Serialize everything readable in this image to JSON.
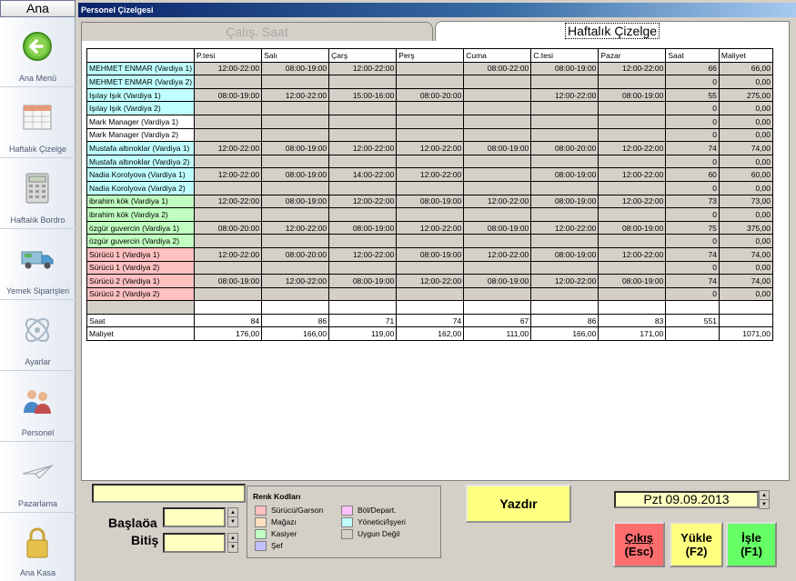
{
  "sidebar": {
    "header": "Ana",
    "items": [
      {
        "label": "Ana Menü",
        "icon": "back-arrow-icon"
      },
      {
        "label": "Haftalık Çizelge",
        "icon": "calendar-icon"
      },
      {
        "label": "Haftalık Bordro",
        "icon": "calculator-icon"
      },
      {
        "label": "Yemek Siparişleri",
        "icon": "delivery-truck-icon"
      },
      {
        "label": "Ayarlar",
        "icon": "settings-icon"
      },
      {
        "label": "Personel",
        "icon": "people-icon"
      },
      {
        "label": "Pazarlama",
        "icon": "paper-plane-icon"
      },
      {
        "label": "Ana Kasa",
        "icon": "lock-icon"
      }
    ]
  },
  "window": {
    "title": "Personel Çizelgesi"
  },
  "tabs": {
    "calis": "Çalış. Saat",
    "haftalik": "Haftalık Çizelge"
  },
  "grid": {
    "headers": [
      "",
      "P.tesi",
      "Salı",
      "Çarş",
      "Perş",
      "Cuma",
      "C.tesi",
      "Pazar",
      "Saat",
      "Maliyet"
    ],
    "rows": [
      {
        "name": "MEHMET ENMAR (Vardiya 1)",
        "color": "#c0ffff",
        "cells": [
          "12:00-22:00",
          "08:00-19:00",
          "12:00-22:00",
          "",
          "08:00-22:00",
          "08:00-19:00",
          "12:00-22:00"
        ],
        "saat": "66",
        "maliyet": "66,00"
      },
      {
        "name": "MEHMET ENMAR (Vardiya 2)",
        "color": "#c0ffff",
        "cells": [
          "",
          "",
          "",
          "",
          "",
          "",
          ""
        ],
        "saat": "0",
        "maliyet": "0,00"
      },
      {
        "name": "Işılay Işık (Vardiya 1)",
        "color": "#c0ffff",
        "cells": [
          "08:00-19:00",
          "12:00-22:00",
          "15:00-16:00",
          "08:00-20:00",
          "",
          "12:00-22:00",
          "08:00-19:00"
        ],
        "saat": "55",
        "maliyet": "275,00"
      },
      {
        "name": "Işılay Işık (Vardiya 2)",
        "color": "#c0ffff",
        "cells": [
          "",
          "",
          "",
          "",
          "",
          "",
          ""
        ],
        "saat": "0",
        "maliyet": "0,00"
      },
      {
        "name": "Mark Manager (Vardiya 1)",
        "color": "#ffffff",
        "cells": [
          "",
          "",
          "",
          "",
          "",
          "",
          ""
        ],
        "saat": "0",
        "maliyet": "0,00"
      },
      {
        "name": "Mark Manager (Vardiya 2)",
        "color": "#ffffff",
        "cells": [
          "",
          "",
          "",
          "",
          "",
          "",
          ""
        ],
        "saat": "0",
        "maliyet": "0,00"
      },
      {
        "name": "Mustafa altınoklar (Vardiya 1)",
        "color": "#c0ffff",
        "cells": [
          "12:00-22:00",
          "08:00-19:00",
          "12:00-22:00",
          "12:00-22:00",
          "08:00-19:00",
          "08:00-20:00",
          "12:00-22:00"
        ],
        "saat": "74",
        "maliyet": "74,00"
      },
      {
        "name": "Mustafa altınoklar (Vardiya 2)",
        "color": "#c0ffff",
        "cells": [
          "",
          "",
          "",
          "",
          "",
          "",
          ""
        ],
        "saat": "0",
        "maliyet": "0,00"
      },
      {
        "name": "Nadia Korolyova (Vardiya 1)",
        "color": "#c0ffff",
        "cells": [
          "12:00-22:00",
          "08:00-19:00",
          "14:00-22:00",
          "12:00-22:00",
          "",
          "08:00-19:00",
          "12:00-22:00"
        ],
        "saat": "60",
        "maliyet": "60,00"
      },
      {
        "name": "Nadia Korolyova (Vardiya 2)",
        "color": "#c0ffff",
        "cells": [
          "",
          "",
          "",
          "",
          "",
          "",
          ""
        ],
        "saat": "0",
        "maliyet": "0,00"
      },
      {
        "name": "ibrahim kök (Vardiya 1)",
        "color": "#c0ffc0",
        "cells": [
          "12:00-22:00",
          "08:00-19:00",
          "12:00-22:00",
          "08:00-19:00",
          "12:00-22:00",
          "08:00-19:00",
          "12:00-22:00"
        ],
        "saat": "73",
        "maliyet": "73,00"
      },
      {
        "name": "ibrahim kök (Vardiya 2)",
        "color": "#c0ffc0",
        "cells": [
          "",
          "",
          "",
          "",
          "",
          "",
          ""
        ],
        "saat": "0",
        "maliyet": "0,00"
      },
      {
        "name": "özgür guvercin (Vardiya 1)",
        "color": "#c0ffc0",
        "cells": [
          "08:00-20:00",
          "12:00-22:00",
          "08:00-19:00",
          "12:00-22:00",
          "08:00-19:00",
          "12:00-22:00",
          "08:00-19:00"
        ],
        "saat": "75",
        "maliyet": "375,00"
      },
      {
        "name": "özgür guvercin (Vardiya 2)",
        "color": "#c0ffc0",
        "cells": [
          "",
          "",
          "",
          "",
          "",
          "",
          ""
        ],
        "saat": "0",
        "maliyet": "0,00"
      },
      {
        "name": "Sürücü 1 (Vardiya 1)",
        "color": "#ffc0c0",
        "cells": [
          "12:00-22:00",
          "08:00-20:00",
          "12:00-22:00",
          "08:00-19:00",
          "12:00-22:00",
          "08:00-19:00",
          "12:00-22:00"
        ],
        "saat": "74",
        "maliyet": "74,00"
      },
      {
        "name": "Sürücü 1 (Vardiya 2)",
        "color": "#ffc0c0",
        "cells": [
          "",
          "",
          "",
          "",
          "",
          "",
          ""
        ],
        "saat": "0",
        "maliyet": "0,00"
      },
      {
        "name": "Sürücü 2 (Vardiya 1)",
        "color": "#ffc0c0",
        "cells": [
          "08:00-19:00",
          "12:00-22:00",
          "08:00-19:00",
          "12:00-22:00",
          "08:00-19:00",
          "12:00-22:00",
          "08:00-19:00"
        ],
        "saat": "74",
        "maliyet": "74,00"
      },
      {
        "name": "Sürücü 2 (Vardiya 2)",
        "color": "#ffc0c0",
        "cells": [
          "",
          "",
          "",
          "",
          "",
          "",
          ""
        ],
        "saat": "0",
        "maliyet": "0,00"
      }
    ],
    "totals": [
      {
        "label": "Saat",
        "values": [
          "84",
          "86",
          "71",
          "74",
          "67",
          "86",
          "83",
          "551",
          ""
        ]
      },
      {
        "label": "Maliyet",
        "values": [
          "176,00",
          "166,00",
          "119,00",
          "162,00",
          "111,00",
          "166,00",
          "171,00",
          "",
          "1071,00"
        ]
      }
    ]
  },
  "controls": {
    "name_value": "",
    "baslangic_label": "Başlaöa",
    "bitis_label": "Bitiş",
    "baslangic_value": "",
    "bitis_value": ""
  },
  "legend": {
    "title": "Renk Kodları",
    "items": [
      {
        "label": "Sürücü/Garson",
        "color": "#ffc0c0"
      },
      {
        "label": "Mağazı",
        "color": "#ffe0c0"
      },
      {
        "label": "Kasiyer",
        "color": "#c0ffc0"
      },
      {
        "label": "Şef",
        "color": "#c0c0ff"
      },
      {
        "label": "Böl/Depart.",
        "color": "#ffc0ff"
      },
      {
        "label": "Yönetici/İşyeri",
        "color": "#c0ffff"
      },
      {
        "label": "Uygun Değil",
        "color": "#d4d0c8"
      }
    ]
  },
  "buttons": {
    "yazdir": "Yazdır",
    "cikis": "Çıkış",
    "cikis_key": "(Esc)",
    "yukle": "Yükle",
    "yukle_key": "(F2)",
    "isle": "İşle",
    "isle_key": "(F1)"
  },
  "date_display": "Pzt 09.09.2013"
}
